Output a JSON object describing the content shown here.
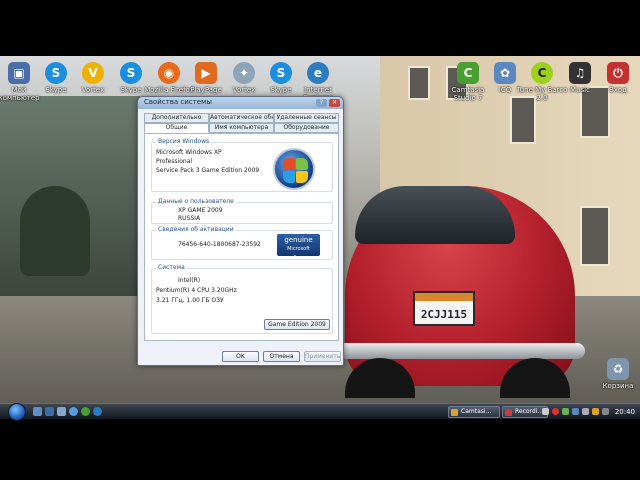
{
  "desktop": {
    "icons": [
      {
        "label": "Мой компьютер",
        "icon": "computer-icon",
        "color": "#4a6fa5"
      },
      {
        "label": "Skype",
        "icon": "skype-icon",
        "color": "#1b8ee0"
      },
      {
        "label": "Vortex",
        "icon": "vortex-icon",
        "color": "#f0b000"
      },
      {
        "label": "Skype",
        "icon": "skype-icon",
        "color": "#1b8ee0"
      },
      {
        "label": "Mozilla Firefox",
        "icon": "firefox-icon",
        "color": "#e86a1a"
      },
      {
        "label": "PlayPage",
        "icon": "playpage-icon",
        "color": "#e06a20"
      },
      {
        "label": "Vortex",
        "icon": "vortex-icon",
        "color": "#8ca4b8"
      },
      {
        "label": "Skype",
        "icon": "skype-icon",
        "color": "#1b8ee0"
      },
      {
        "label": "Internet Explorer",
        "icon": "ie-icon",
        "color": "#2d7cc2"
      },
      {
        "label": "Camtasia Studio 7",
        "icon": "camtasia-icon",
        "color": "#47a030"
      },
      {
        "label": "ICQ",
        "icon": "icq-icon",
        "color": "#5c88bf"
      },
      {
        "label": "Tune My Barco 2.0",
        "icon": "tune-icon",
        "color": "#9cd11a"
      },
      {
        "label": "Music",
        "icon": "music-icon",
        "color": "#333333"
      },
      {
        "label": "Вход",
        "icon": "power-icon",
        "color": "#c53030"
      }
    ],
    "recycle_bin": {
      "label": "Корзина",
      "icon": "recycle-bin-icon"
    }
  },
  "dialog": {
    "title": "Свойства системы",
    "tabs_back": [
      "Дополнительно",
      "Автоматическое обновление",
      "Удаленные сеансы"
    ],
    "tabs_front": [
      "Общие",
      "Имя компьютера",
      "Оборудование"
    ],
    "active_tab": "Общие",
    "system": {
      "label": "Версия Windows",
      "lines": [
        "Microsoft Windows XP",
        "Professional",
        "Service Pack 3 Game Edition 2009"
      ]
    },
    "user": {
      "label": "Данные о пользователе",
      "lines": [
        "XP GAME 2009",
        "RUSSIA"
      ]
    },
    "activation": {
      "label": "Сведения об активации",
      "serial": "76456-640-1800687-23592",
      "badge_main": "genuine",
      "badge_sub": "Microsoft software"
    },
    "computer": {
      "label": "Система",
      "lines": [
        "Intel(R)",
        "Pentium(R) 4 CPU 3.20GHz",
        "3.21 ГГц, 1.00 ГБ ОЗУ"
      ],
      "edition_button": "Game Edition 2009"
    },
    "buttons": {
      "ok": "OK",
      "cancel": "Отмена",
      "apply": "Применить"
    }
  },
  "taskbar": {
    "tasks": [
      {
        "label": "Camtasi...",
        "icon": "camtasia-icon",
        "color": "#d8a23a"
      },
      {
        "label": "Recordi...",
        "icon": "record-icon",
        "color": "#c93a3a"
      }
    ],
    "clock": "20:40"
  },
  "colors": {
    "accent": "#1d4f8f",
    "taskbar": "#1c232d"
  }
}
